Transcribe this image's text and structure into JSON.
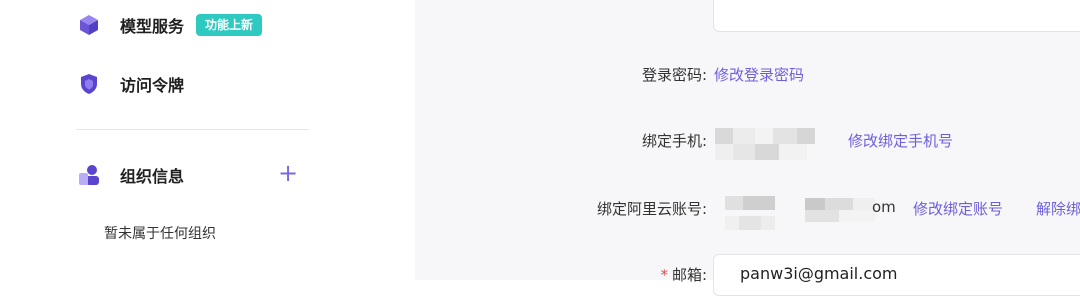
{
  "sidebar": {
    "items": [
      {
        "label": "模型服务",
        "icon": "cube-icon",
        "badge": "功能上新"
      },
      {
        "label": "访问令牌",
        "icon": "shield-icon"
      }
    ],
    "org": {
      "label": "组织信息",
      "icon": "users-icon",
      "add_icon": "plus-icon",
      "empty_text": "暂未属于任何组织"
    }
  },
  "account": {
    "password": {
      "label": "登录密码:",
      "action": "修改登录密码"
    },
    "phone": {
      "label": "绑定手机:",
      "action": "修改绑定手机号"
    },
    "aliyun": {
      "label": "绑定阿里云账号:",
      "value_suffix": "om",
      "action": "修改绑定账号",
      "action2": "解除绑"
    },
    "email": {
      "label": "邮箱:",
      "required_mark": "*",
      "value": "panw3i@gmail.com"
    }
  },
  "colors": {
    "accent": "#6d5fdc",
    "badge": "#2ec9c1",
    "icon_purple": "#6b55d6"
  }
}
